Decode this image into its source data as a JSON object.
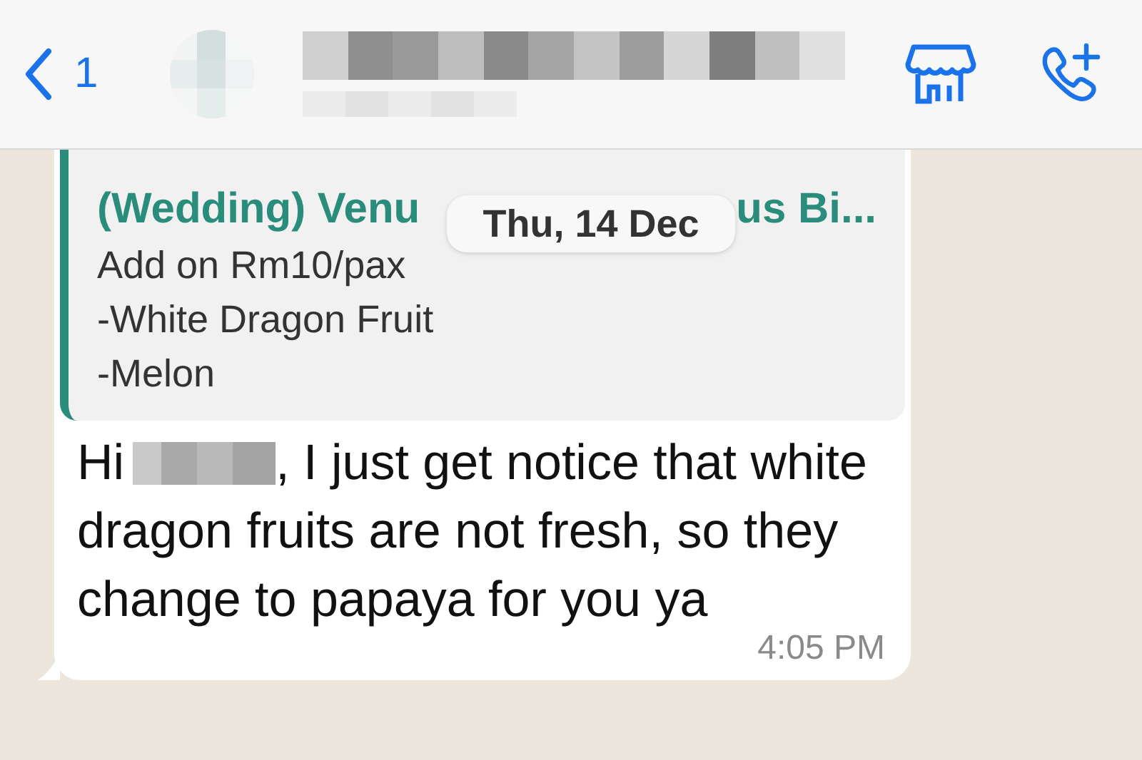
{
  "header": {
    "back_count": "1"
  },
  "date_pill": "Thu, 14 Dec",
  "message": {
    "quote": {
      "title_start": "(Wedding) Venu",
      "title_end": "us Bi...",
      "lines": [
        "Add on Rm10/pax",
        "-White Dragon Fruit",
        "-Melon"
      ]
    },
    "greeting": "Hi",
    "body": ", I just get notice that white dragon fruits are not fresh, so they change to papaya for you ya",
    "time": "4:05 PM"
  }
}
